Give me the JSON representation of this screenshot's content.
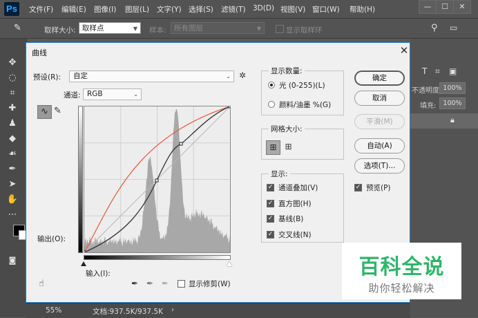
{
  "app": {
    "logo": "Ps"
  },
  "menu": [
    "文件(F)",
    "编辑(E)",
    "图像(I)",
    "图层(L)",
    "文字(Y)",
    "选择(S)",
    "滤镜(T)",
    "3D(D)",
    "视图(V)",
    "窗口(W)",
    "帮助(H)"
  ],
  "window_controls": {
    "minimize": "—",
    "restore": "☐",
    "close": "✕"
  },
  "options_bar": {
    "sample_size_label": "取样大小:",
    "sample_size_value": "取样点",
    "sample_label": "样本:",
    "sample_value": "所有图层",
    "show_ring_label": "显示取样环"
  },
  "right_panel": {
    "opacity_label": "不透明度:",
    "opacity_value": "100%",
    "fill_label": "填充:",
    "fill_value": "100%"
  },
  "status": {
    "zoom": "55%",
    "doc": "文档:937.5K/937.5K"
  },
  "dialog": {
    "title": "曲线",
    "close": "✕",
    "preset_label": "预设(R):",
    "preset_value": "自定",
    "channel_label": "通道:",
    "channel_value": "RGB",
    "output_label": "输出(O):",
    "input_label": "输入(I):",
    "show_clipping_label": "显示修剪(W)",
    "display_amount": {
      "title": "显示数量:",
      "options": [
        "光 (0-255)(L)",
        "颜料/油墨 %(G)"
      ],
      "selected": 0
    },
    "grid_size": {
      "title": "网格大小:"
    },
    "show": {
      "title": "显示:",
      "options": [
        "通道叠加(V)",
        "直方图(H)",
        "基线(B)",
        "交叉线(N)"
      ],
      "checked": [
        true,
        true,
        true,
        true
      ]
    },
    "buttons": {
      "ok": "确定",
      "cancel": "取消",
      "smooth": "平滑(M)",
      "auto": "自动(A)",
      "options": "选项(T)..."
    },
    "preview": {
      "label": "预览(P)",
      "checked": true
    },
    "colors": {
      "curve": "#333333",
      "red_channel": "#e8543c",
      "histogram": "#a8a8a8",
      "accent": "#1e7bd6"
    }
  },
  "watermark": {
    "title": "百科全说",
    "subtitle": "助你轻松解决"
  }
}
